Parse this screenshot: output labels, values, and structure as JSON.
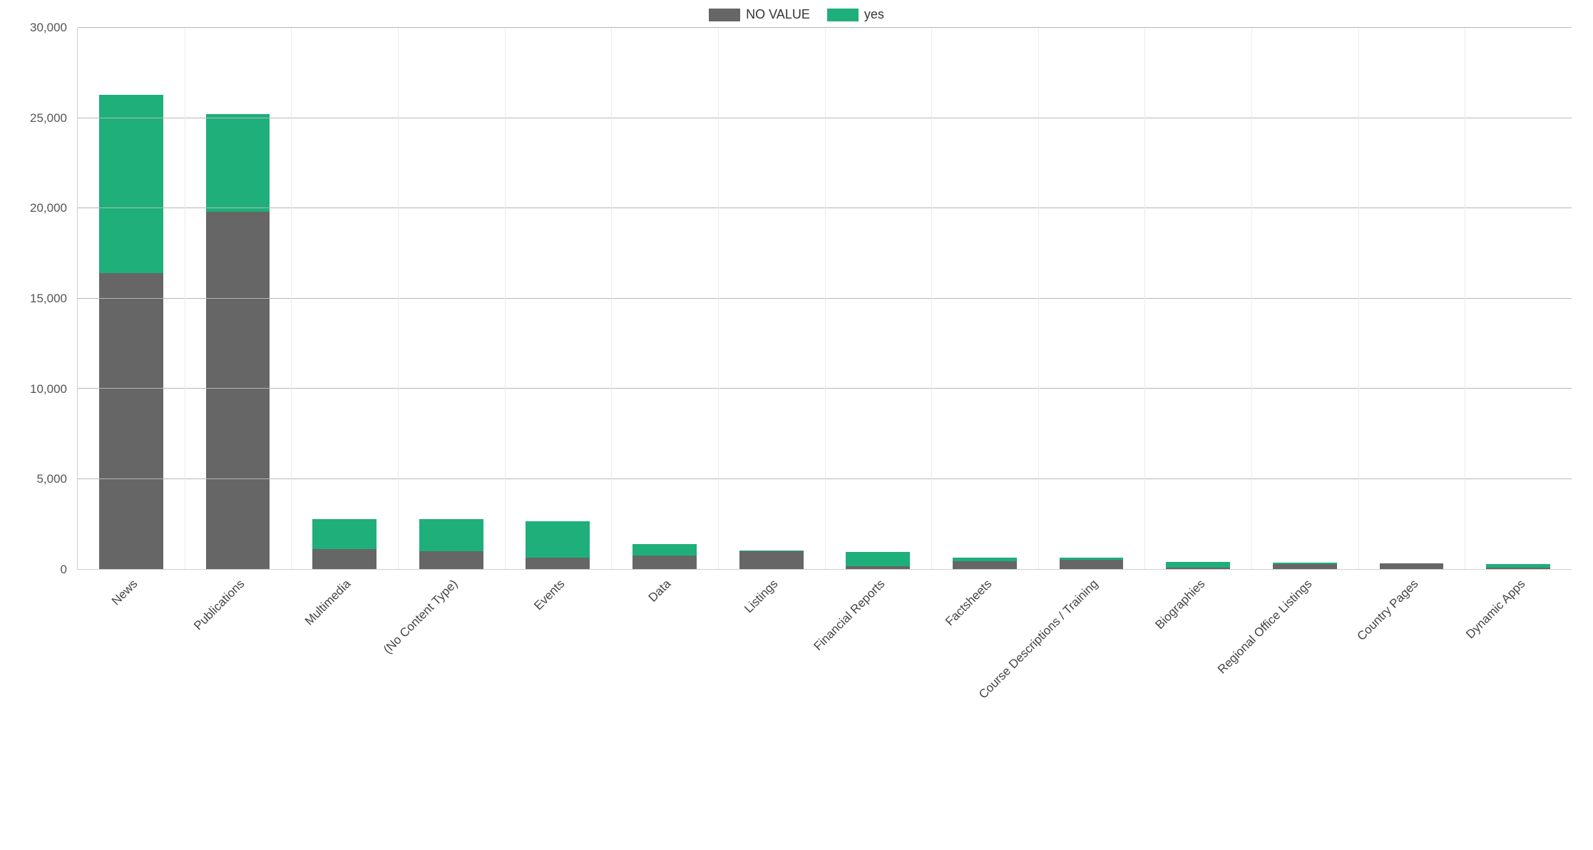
{
  "chart_data": {
    "type": "bar",
    "stacked": true,
    "title": "",
    "xlabel": "",
    "ylabel": "",
    "ylim": [
      0,
      30000
    ],
    "ytick_interval": 5000,
    "categories": [
      "News",
      "Publications",
      "Multimedia",
      "(No Content Type)",
      "Events",
      "Data",
      "Listings",
      "Financial Reports",
      "Factsheets",
      "Course Descriptions / Training",
      "Biographies",
      "Regional Office Listings",
      "Country Pages",
      "Dynamic Apps"
    ],
    "series": [
      {
        "name": "NO VALUE",
        "color": "#666666",
        "values": [
          16400,
          19800,
          1100,
          1000,
          650,
          750,
          970,
          150,
          450,
          500,
          60,
          280,
          300,
          60
        ]
      },
      {
        "name": "yes",
        "color": "#1eaf7a",
        "values": [
          9900,
          5400,
          1650,
          1750,
          2000,
          650,
          50,
          800,
          200,
          130,
          340,
          60,
          20,
          200
        ]
      }
    ],
    "y_ticks": [
      {
        "value": 0,
        "label": "0"
      },
      {
        "value": 5000,
        "label": "5,000"
      },
      {
        "value": 10000,
        "label": "10,000"
      },
      {
        "value": 15000,
        "label": "15,000"
      },
      {
        "value": 20000,
        "label": "20,000"
      },
      {
        "value": 25000,
        "label": "25,000"
      },
      {
        "value": 30000,
        "label": "30,000"
      }
    ],
    "legend_position": "top"
  }
}
